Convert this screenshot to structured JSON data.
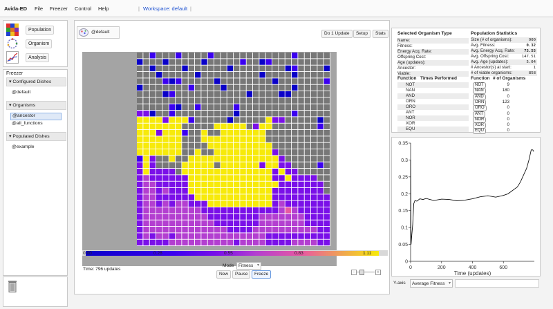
{
  "menubar": {
    "app": "Avida-ED",
    "items": [
      "File",
      "Freezer",
      "Control",
      "Help"
    ],
    "workspace": "Workspace: default"
  },
  "nav": {
    "population": "Population",
    "organism": "Organism",
    "analysis": "Analysis"
  },
  "freezer": {
    "title": "Freezer",
    "configured_header": "Configured Dishes",
    "configured": [
      "@default"
    ],
    "organisms_header": "Organisms",
    "organisms": [
      "@ancestor",
      "@all_functions"
    ],
    "populated_header": "Populated Dishes",
    "populated": [
      "@example"
    ]
  },
  "toolbar": {
    "dish_name": "@default",
    "do1": "Do 1 Update",
    "setup": "Setup",
    "stats": "Stats"
  },
  "scale": {
    "ticks": [
      "0.00",
      "0.28",
      "0.55",
      "0.83",
      "1.11"
    ],
    "time": "Time: 796 updates",
    "mode_label": "Mode",
    "mode_value": "Fitness",
    "new": "New",
    "pause": "Pause",
    "freeze": "Freeze"
  },
  "grid": {
    "rows": 30,
    "cols": 30,
    "colors": [
      "#777777",
      "#0a00c8",
      "#3b00f0",
      "#7a10e8",
      "#b33fd0",
      "#e85aa0",
      "#f7ea0a"
    ],
    "rows_data": [
      "002000200002000000000000200000",
      "100010000010000020012000000000",
      "001000010000001000000001200001",
      "000100000100000000010000100000",
      "000021200000100000000100000002",
      "100000002000010000000000100000",
      "000012000000000001000011000000",
      "000000000000000000000000000000",
      "000002100200000200000000000000",
      "331002000000000100000000200000",
      "666636662000001000006330000010",
      "666666600000666660366000000020",
      "666366620060066666660000000000",
      "666666600066666666660000000000",
      "666666600006666666666000000000",
      "666666600600666666666300000000",
      "263006006666666666666630000000",
      "363000066666066666636633000020",
      "363333066666666666666363300000",
      "343333336666666666666336333300",
      "344333336666666666666633333330",
      "344343336666666666666333333330",
      "344333333666666666666333333333",
      "344343443336666666666343333333",
      "344444444433333333333345433333",
      "344444444443333333344444443333",
      "344444444444333333344444443333",
      "344444444444443333444444444433",
      "343443444444444444443333333333",
      "333334444444444344443333444433"
    ]
  },
  "selected_organism": {
    "title": "Selected Organism Type",
    "fields": [
      "Name:",
      "Fitness:",
      "Energy Acq. Rate:",
      "Offspring Cost:",
      "Age (updates):",
      "Ancestor:",
      "Viable:"
    ],
    "func_col": "Function",
    "times_col": "Times Performed",
    "functions": [
      "NOT",
      "NAN",
      "AND",
      "ORN",
      "ORO",
      "ANT",
      "NOR",
      "XOR",
      "EQU"
    ]
  },
  "population_stats": {
    "title": "Population Statistics",
    "rows": [
      {
        "label": "Size (# of organisms):",
        "value": "900"
      },
      {
        "label": "Avg. Fitness:",
        "value": "0.32"
      },
      {
        "label": "Avg. Energy Acq. Rate:",
        "value": "75.55"
      },
      {
        "label": "Avg. Offspring Cost:",
        "value": "147.51"
      },
      {
        "label": "Avg. Age (updates):",
        "value": "5.04"
      },
      {
        "label": "# Ancestor(s) at start:",
        "value": "1"
      },
      {
        "label": "# of viable organisms:",
        "value": "858"
      }
    ],
    "func_col": "Function",
    "count_col": "# of Organisms",
    "functions": [
      {
        "name": "NOT",
        "count": "9"
      },
      {
        "name": "NAN",
        "count": "180"
      },
      {
        "name": "AND",
        "count": "0"
      },
      {
        "name": "ORN",
        "count": "123"
      },
      {
        "name": "ORO",
        "count": "0"
      },
      {
        "name": "ANT",
        "count": "0"
      },
      {
        "name": "NOR",
        "count": "0"
      },
      {
        "name": "XOR",
        "count": "0"
      },
      {
        "name": "EQU",
        "count": "0"
      }
    ]
  },
  "yaxis": {
    "label": "Y-axis",
    "value": "Average Fitness"
  },
  "chart_data": {
    "type": "line",
    "xlabel": "Time (updates)",
    "ylabel": "",
    "xlim": [
      0,
      800
    ],
    "ylim": [
      0,
      0.35
    ],
    "xticks": [
      "0",
      "200",
      "400",
      "600"
    ],
    "yticks": [
      "0",
      "0.05",
      "0.1",
      "0.15",
      "0.2",
      "0.25",
      "0.3",
      "0.35"
    ],
    "series": [
      {
        "x": [
          0,
          3,
          8,
          14,
          20,
          28,
          40,
          60,
          80,
          100,
          150,
          200,
          250,
          300,
          350,
          400,
          450,
          500,
          550,
          600,
          630,
          660,
          690,
          710,
          730,
          750,
          765,
          780,
          790,
          796
        ],
        "y": [
          0.3,
          0.05,
          0.08,
          0.11,
          0.17,
          0.18,
          0.178,
          0.185,
          0.183,
          0.186,
          0.18,
          0.184,
          0.183,
          0.179,
          0.181,
          0.185,
          0.191,
          0.194,
          0.19,
          0.195,
          0.2,
          0.21,
          0.22,
          0.235,
          0.255,
          0.275,
          0.3,
          0.33,
          0.33,
          0.325
        ]
      }
    ]
  }
}
